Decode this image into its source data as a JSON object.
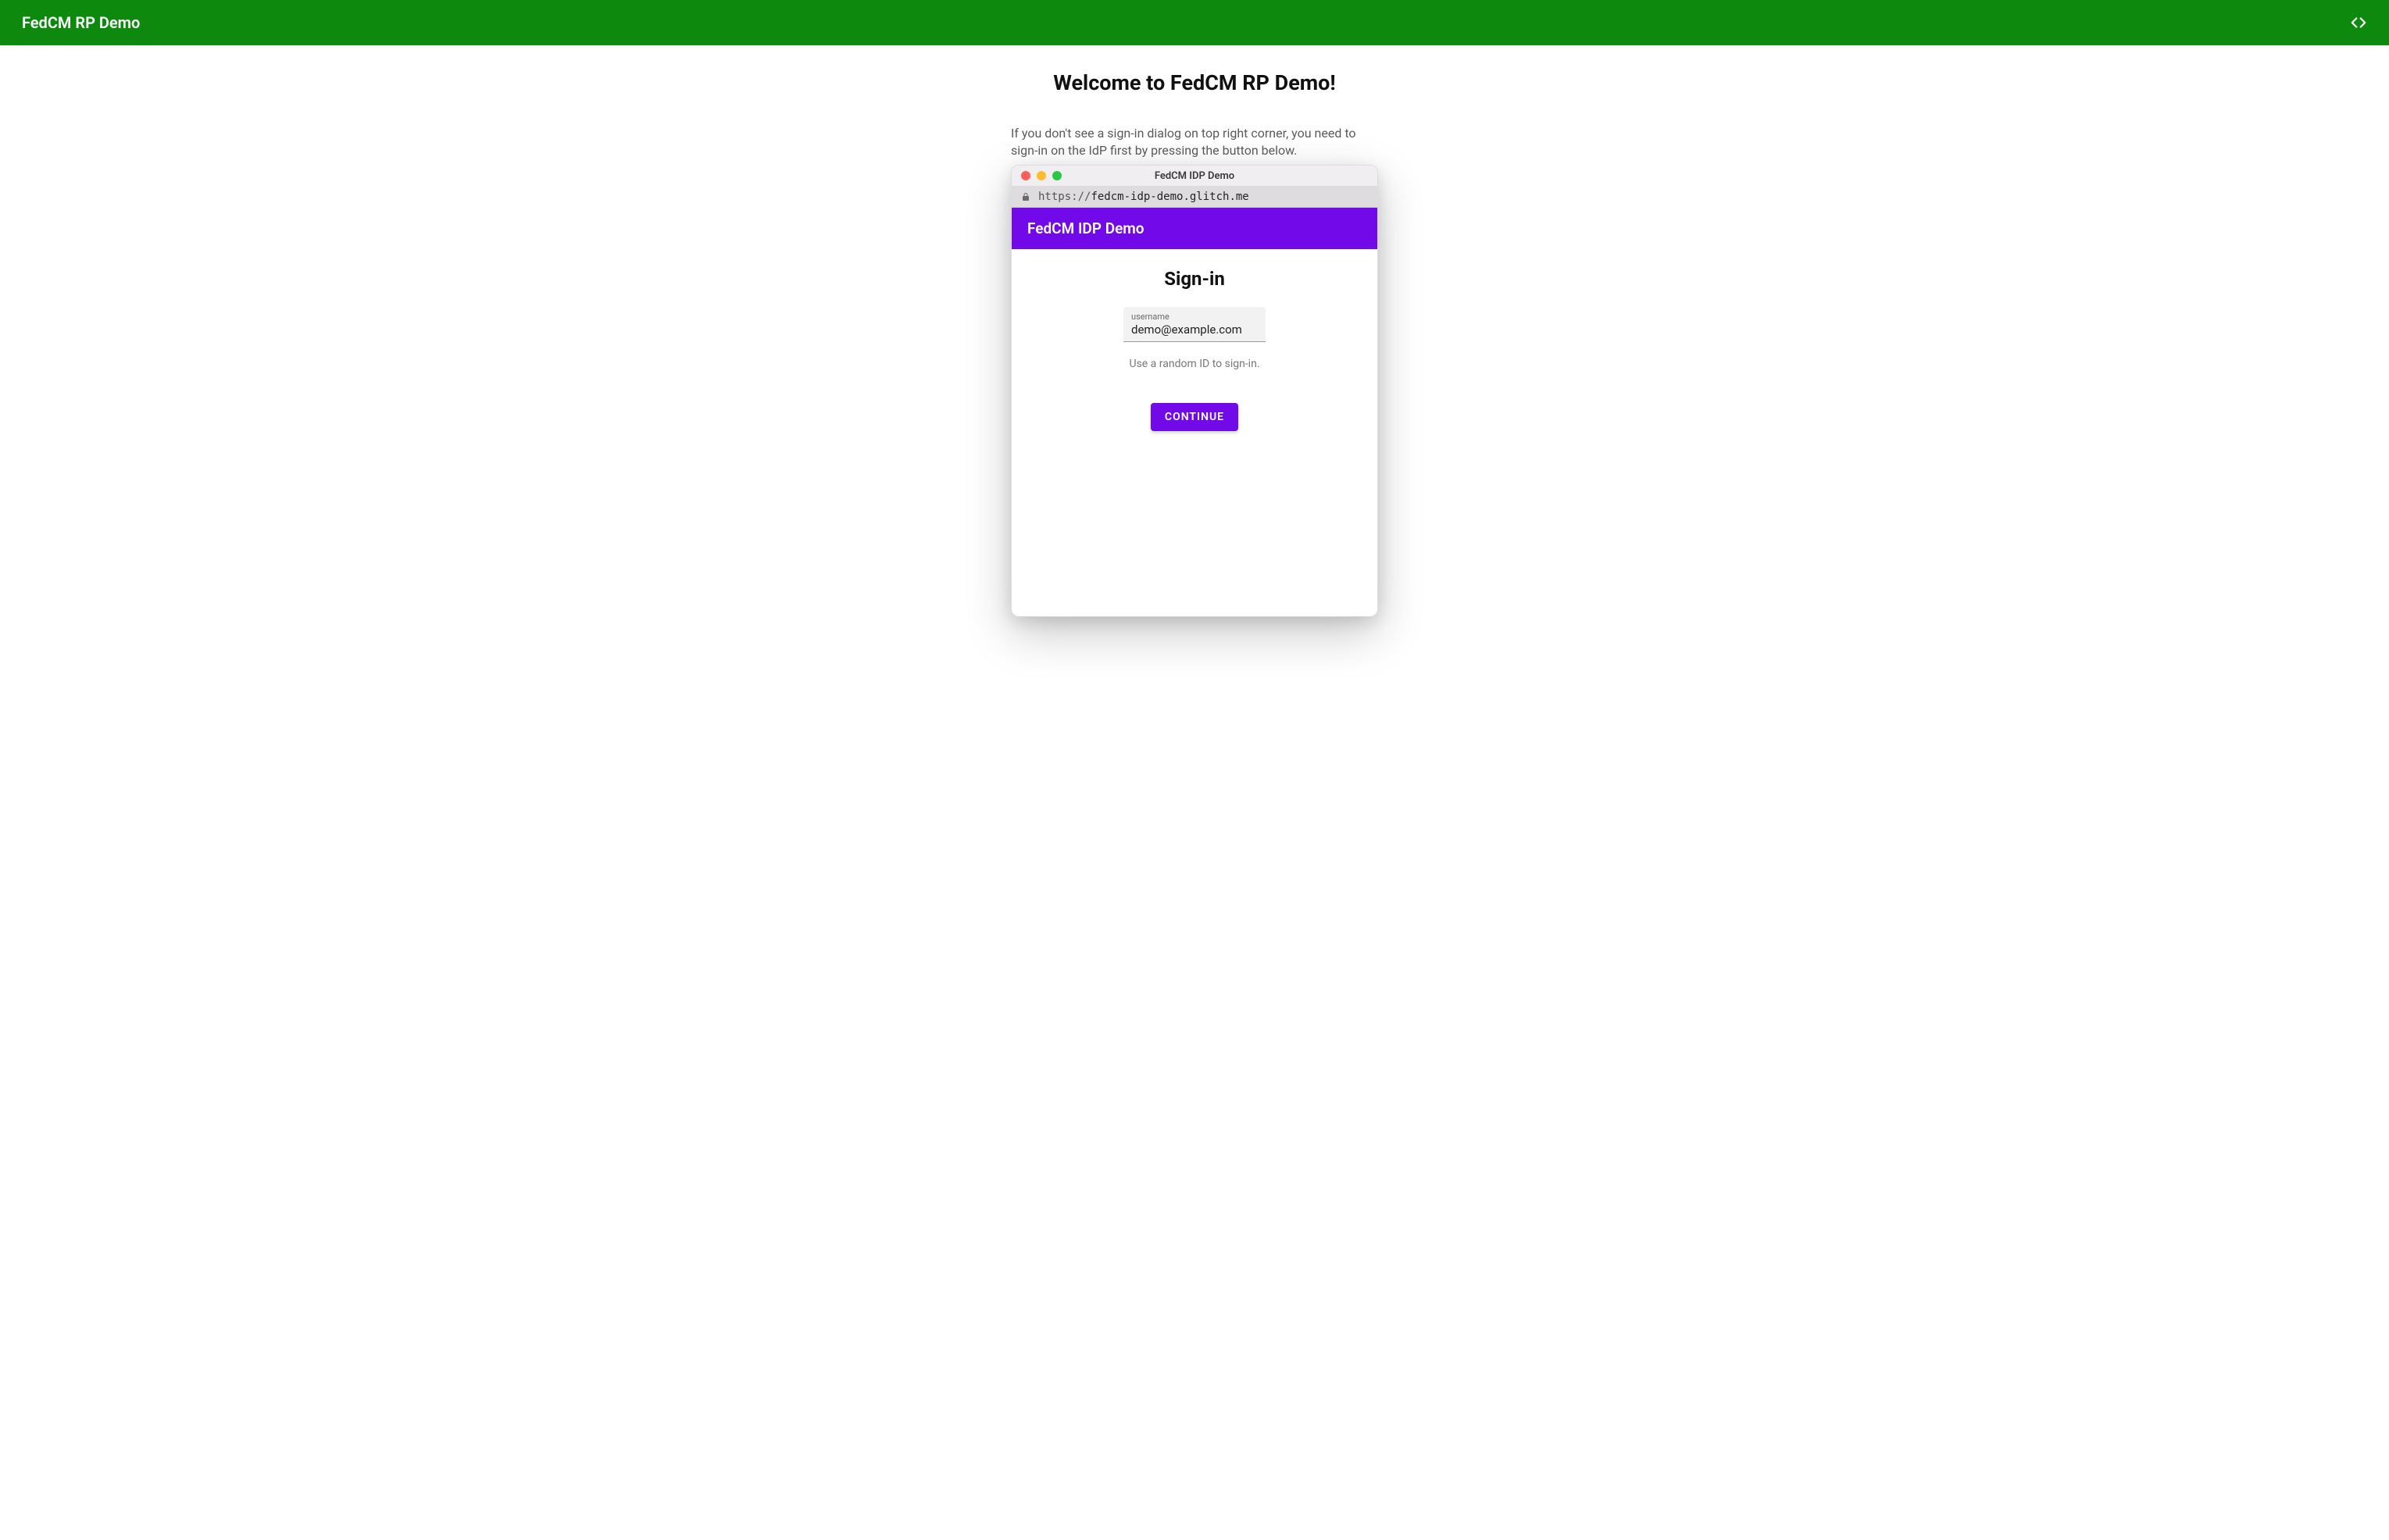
{
  "header": {
    "title": "FedCM RP Demo"
  },
  "page": {
    "heading": "Welcome to FedCM RP Demo!",
    "description": "If you don't see a sign-in dialog on top right corner, you need to sign-in on the IdP first by pressing the button below."
  },
  "window": {
    "title": "FedCM IDP Demo",
    "url_protocol": "https://",
    "url_domain": "fedcm-idp-demo.glitch.me"
  },
  "inner": {
    "header_title": "FedCM IDP Demo",
    "signin_heading": "Sign-in",
    "username_label": "username",
    "username_value": "demo@example.com",
    "helper_text": "Use a random ID to sign-in.",
    "continue_label": "CONTINUE"
  },
  "colors": {
    "outer_bar": "#0d8a0d",
    "inner_bar": "#7209e8"
  }
}
